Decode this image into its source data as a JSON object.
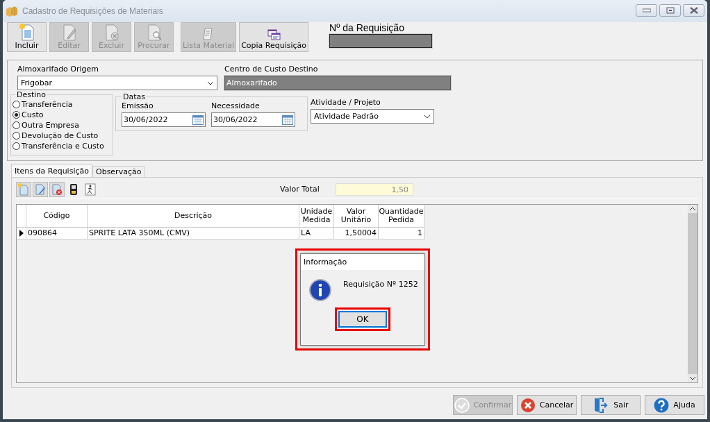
{
  "window": {
    "title": "Cadastro de Requisições de Materiais"
  },
  "toolbar": [
    {
      "label": "Incluir",
      "disabled": false
    },
    {
      "label": "Editar",
      "disabled": true
    },
    {
      "label": "Excluir",
      "disabled": true
    },
    {
      "label": "Procurar",
      "disabled": true
    },
    {
      "label": "Lista Material",
      "disabled": true
    },
    {
      "label": "Copia Requisição",
      "disabled": false
    }
  ],
  "requisition_number": {
    "label": "Nº da Requisição"
  },
  "origin": {
    "label": "Almoxarifado Origem",
    "value": "Frigobar"
  },
  "cost_center": {
    "label": "Centro de Custo Destino",
    "value": "Almoxarifado"
  },
  "destino": {
    "label": "Destino",
    "options": [
      {
        "label": "Transferência",
        "selected": false
      },
      {
        "label": "Custo",
        "selected": true
      },
      {
        "label": "Outra Empresa",
        "selected": false
      },
      {
        "label": "Devolução de Custo",
        "selected": false
      },
      {
        "label": "Transferência e Custo",
        "selected": false
      }
    ]
  },
  "datas": {
    "label": "Datas",
    "fields": [
      {
        "label": "Emissão",
        "value": "30/06/2022"
      },
      {
        "label": "Necessidade",
        "value": "30/06/2022"
      }
    ]
  },
  "activity": {
    "label": "Atividade / Projeto",
    "value": "Atividade Padrão"
  },
  "tabs": [
    {
      "label": "Itens da Requisição",
      "selected": true
    },
    {
      "label": "Observação",
      "selected": false
    }
  ],
  "items": {
    "total_label": "Valor Total",
    "total": "1,50",
    "columns": [
      "Código",
      "Descrição",
      "Unidade Medida",
      "Valor Unitário",
      "Quantidade Pedida"
    ],
    "rows": [
      {
        "current": true,
        "cells": [
          "090864",
          "SPRITE LATA 350ML (CMV)",
          "LA",
          "1,50004",
          "1"
        ]
      }
    ]
  },
  "dialog": {
    "title": "Informação",
    "message": "Requisição Nº 1252",
    "button": "OK",
    "highlighted": true,
    "button_highlighted": true
  },
  "buttons": [
    {
      "label": "Confirmar",
      "disabled": true
    },
    {
      "label": "Cancelar",
      "disabled": false
    },
    {
      "label": "Sair",
      "disabled": false
    },
    {
      "label": "Ajuda",
      "disabled": false
    }
  ]
}
